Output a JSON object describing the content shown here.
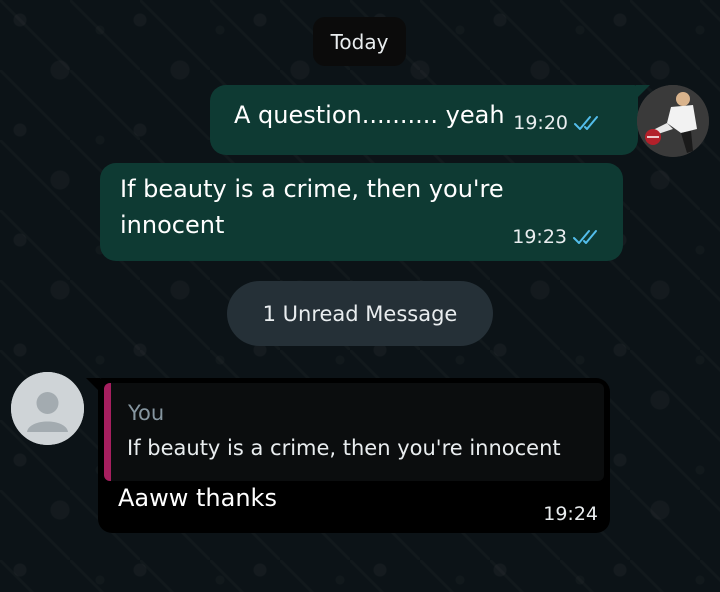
{
  "chat": {
    "date_divider": "Today",
    "unread_divider": "1 Unread Message"
  },
  "messages": {
    "outgoing_1": {
      "text": "A question.......... yeah",
      "time": "19:20",
      "status_icon": "double-check-read-icon"
    },
    "outgoing_2": {
      "text": "If beauty is a crime, then you're innocent",
      "time": "19:23",
      "status_icon": "double-check-read-icon"
    },
    "incoming_1": {
      "quoted_author": "You",
      "quoted_text": "If beauty is a crime, then you're innocent",
      "text": "Aaww thanks",
      "time": "19:24"
    }
  },
  "colors": {
    "background": "#0c1317",
    "outgoing_bubble": "#0e3a33",
    "incoming_bubble": "#000000",
    "read_tick": "#53bdeb",
    "quote_bar": "#a61f5f",
    "unread_pill": "#253037"
  }
}
